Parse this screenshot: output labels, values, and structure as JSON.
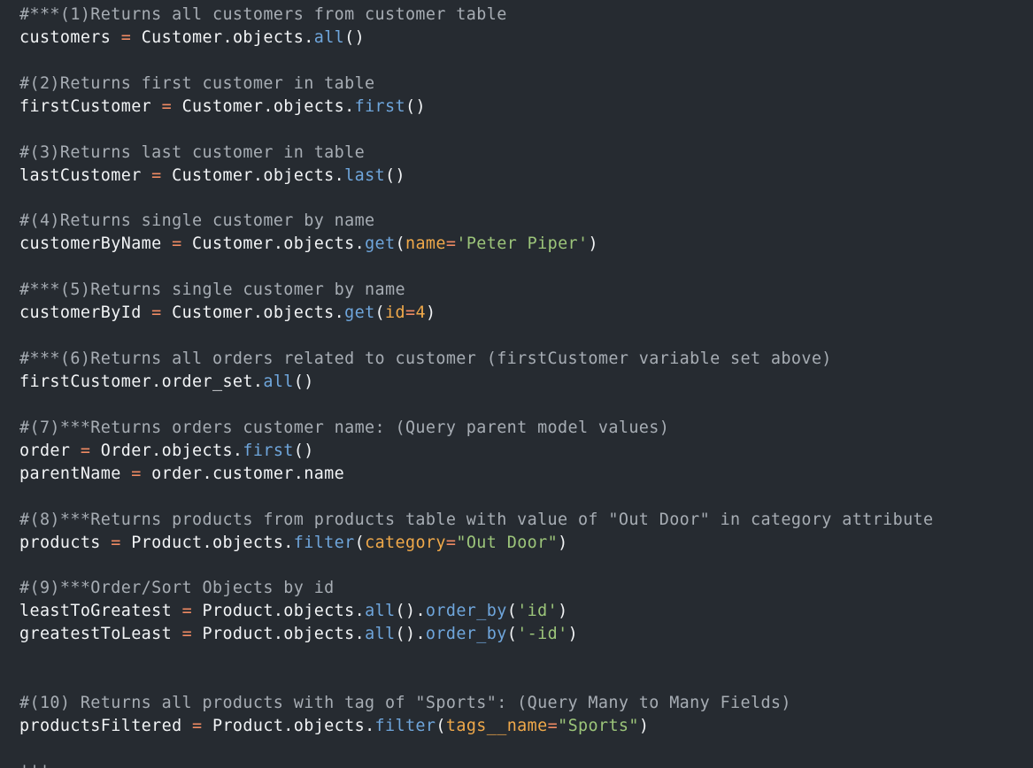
{
  "code_lines": [
    [
      {
        "t": "comment",
        "v": "#***(1)Returns all customers from customer table"
      }
    ],
    [
      {
        "t": "plain",
        "v": "customers "
      },
      {
        "t": "op",
        "v": "="
      },
      {
        "t": "plain",
        "v": " Customer.objects."
      },
      {
        "t": "method",
        "v": "all"
      },
      {
        "t": "plain",
        "v": "()"
      }
    ],
    [],
    [
      {
        "t": "comment",
        "v": "#(2)Returns first customer in table"
      }
    ],
    [
      {
        "t": "plain",
        "v": "firstCustomer "
      },
      {
        "t": "op",
        "v": "="
      },
      {
        "t": "plain",
        "v": " Customer.objects."
      },
      {
        "t": "method",
        "v": "first"
      },
      {
        "t": "plain",
        "v": "()"
      }
    ],
    [],
    [
      {
        "t": "comment",
        "v": "#(3)Returns last customer in table"
      }
    ],
    [
      {
        "t": "plain",
        "v": "lastCustomer "
      },
      {
        "t": "op",
        "v": "="
      },
      {
        "t": "plain",
        "v": " Customer.objects."
      },
      {
        "t": "method",
        "v": "last"
      },
      {
        "t": "plain",
        "v": "()"
      }
    ],
    [],
    [
      {
        "t": "comment",
        "v": "#(4)Returns single customer by name"
      }
    ],
    [
      {
        "t": "plain",
        "v": "customerByName "
      },
      {
        "t": "op",
        "v": "="
      },
      {
        "t": "plain",
        "v": " Customer.objects."
      },
      {
        "t": "method",
        "v": "get"
      },
      {
        "t": "plain",
        "v": "("
      },
      {
        "t": "kw",
        "v": "name"
      },
      {
        "t": "op",
        "v": "="
      },
      {
        "t": "str",
        "v": "'Peter Piper'"
      },
      {
        "t": "plain",
        "v": ")"
      }
    ],
    [],
    [
      {
        "t": "comment",
        "v": "#***(5)Returns single customer by name"
      }
    ],
    [
      {
        "t": "plain",
        "v": "customerById "
      },
      {
        "t": "op",
        "v": "="
      },
      {
        "t": "plain",
        "v": " Customer.objects."
      },
      {
        "t": "method",
        "v": "get"
      },
      {
        "t": "plain",
        "v": "("
      },
      {
        "t": "kw",
        "v": "id"
      },
      {
        "t": "op",
        "v": "="
      },
      {
        "t": "num",
        "v": "4"
      },
      {
        "t": "plain",
        "v": ")"
      }
    ],
    [],
    [
      {
        "t": "comment",
        "v": "#***(6)Returns all orders related to customer (firstCustomer variable set above)"
      }
    ],
    [
      {
        "t": "plain",
        "v": "firstCustomer.order_set."
      },
      {
        "t": "method",
        "v": "all"
      },
      {
        "t": "plain",
        "v": "()"
      }
    ],
    [],
    [
      {
        "t": "comment",
        "v": "#(7)***Returns orders customer name: (Query parent model values)"
      }
    ],
    [
      {
        "t": "plain",
        "v": "order "
      },
      {
        "t": "op",
        "v": "="
      },
      {
        "t": "plain",
        "v": " Order.objects."
      },
      {
        "t": "method",
        "v": "first"
      },
      {
        "t": "plain",
        "v": "()"
      }
    ],
    [
      {
        "t": "plain",
        "v": "parentName "
      },
      {
        "t": "op",
        "v": "="
      },
      {
        "t": "plain",
        "v": " order.customer.name"
      }
    ],
    [],
    [
      {
        "t": "comment",
        "v": "#(8)***Returns products from products table with value of \"Out Door\" in category attribute"
      }
    ],
    [
      {
        "t": "plain",
        "v": "products "
      },
      {
        "t": "op",
        "v": "="
      },
      {
        "t": "plain",
        "v": " Product.objects."
      },
      {
        "t": "method",
        "v": "filter"
      },
      {
        "t": "plain",
        "v": "("
      },
      {
        "t": "kw",
        "v": "category"
      },
      {
        "t": "op",
        "v": "="
      },
      {
        "t": "str",
        "v": "\"Out Door\""
      },
      {
        "t": "plain",
        "v": ")"
      }
    ],
    [],
    [
      {
        "t": "comment",
        "v": "#(9)***Order/Sort Objects by id"
      }
    ],
    [
      {
        "t": "plain",
        "v": "leastToGreatest "
      },
      {
        "t": "op",
        "v": "="
      },
      {
        "t": "plain",
        "v": " Product.objects."
      },
      {
        "t": "method",
        "v": "all"
      },
      {
        "t": "plain",
        "v": "()."
      },
      {
        "t": "method",
        "v": "order_by"
      },
      {
        "t": "plain",
        "v": "("
      },
      {
        "t": "str",
        "v": "'id'"
      },
      {
        "t": "plain",
        "v": ")"
      }
    ],
    [
      {
        "t": "plain",
        "v": "greatestToLeast "
      },
      {
        "t": "op",
        "v": "="
      },
      {
        "t": "plain",
        "v": " Product.objects."
      },
      {
        "t": "method",
        "v": "all"
      },
      {
        "t": "plain",
        "v": "()."
      },
      {
        "t": "method",
        "v": "order_by"
      },
      {
        "t": "plain",
        "v": "("
      },
      {
        "t": "str",
        "v": "'-id'"
      },
      {
        "t": "plain",
        "v": ")"
      }
    ],
    [],
    [],
    [
      {
        "t": "comment",
        "v": "#(10) Returns all products with tag of \"Sports\": (Query Many to Many Fields)"
      }
    ],
    [
      {
        "t": "plain",
        "v": "productsFiltered "
      },
      {
        "t": "op",
        "v": "="
      },
      {
        "t": "plain",
        "v": " Product.objects."
      },
      {
        "t": "method",
        "v": "filter"
      },
      {
        "t": "plain",
        "v": "("
      },
      {
        "t": "kw",
        "v": "tags__name"
      },
      {
        "t": "op",
        "v": "="
      },
      {
        "t": "str",
        "v": "\"Sports\""
      },
      {
        "t": "plain",
        "v": ")"
      }
    ],
    [],
    [
      {
        "t": "comment",
        "v": "'''"
      }
    ]
  ],
  "colors": {
    "background": "#262b31",
    "comment": "#a7adb4",
    "plain": "#f2f4f6",
    "operator": "#ef8a63",
    "method": "#6fa6dc",
    "keyword_arg": "#f0a94a",
    "string": "#9cc57a"
  }
}
